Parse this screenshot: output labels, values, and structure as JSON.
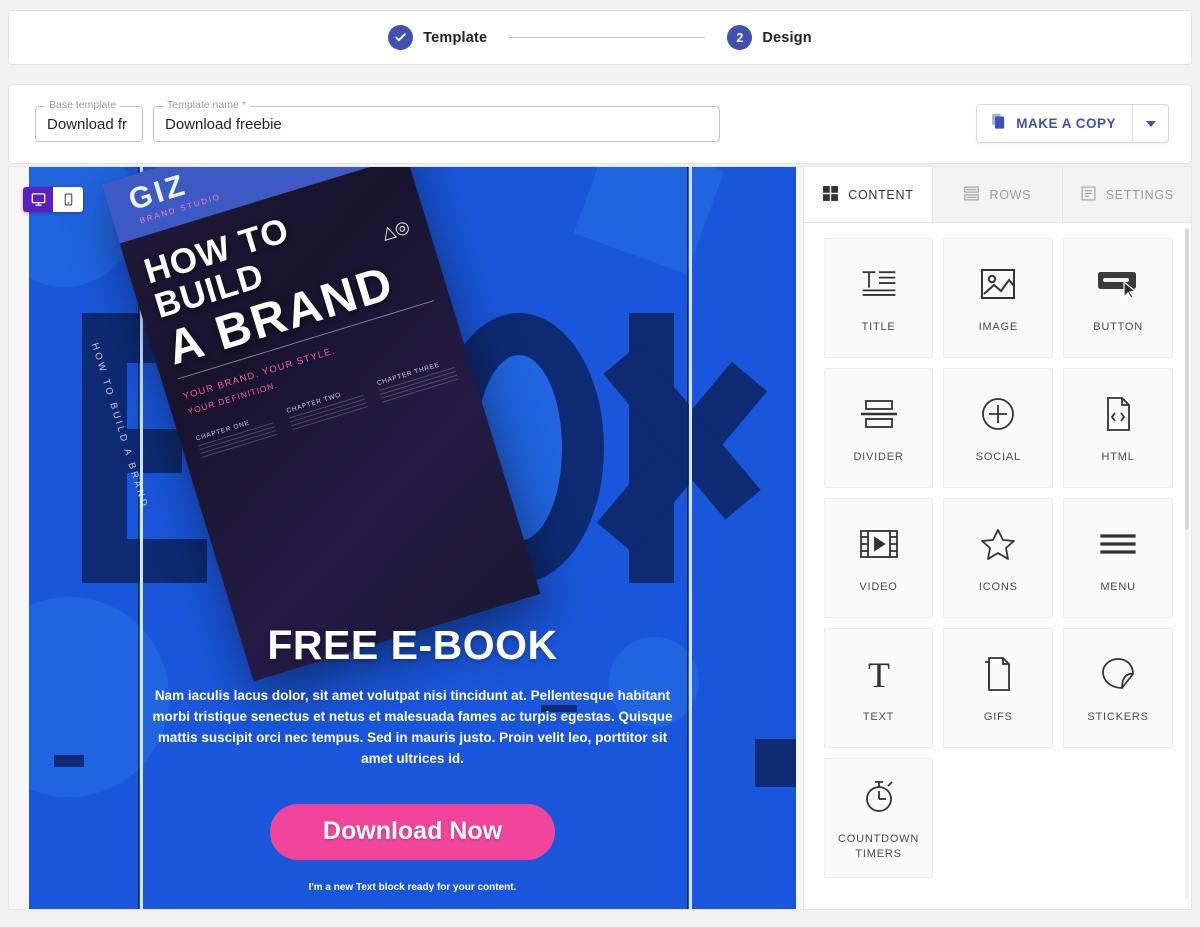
{
  "stepper": {
    "steps": [
      {
        "label": "Template",
        "state": "complete",
        "icon": "check-icon"
      },
      {
        "label": "Design",
        "state": "active",
        "number": "2"
      }
    ]
  },
  "toolbar": {
    "base_template": {
      "legend": "Base template",
      "value": "Download fr"
    },
    "template_name": {
      "legend": "Template name *",
      "value": "Download freebie"
    },
    "make_copy_label": "MAKE A COPY",
    "copy_icon": "copy-icon",
    "caret_icon": "chevron-down-icon",
    "accent": "#3f51b5"
  },
  "canvas": {
    "device_toggle": [
      {
        "name": "desktop",
        "icon": "desktop-icon",
        "active": true
      },
      {
        "name": "mobile",
        "icon": "mobile-icon",
        "active": false
      }
    ],
    "background_color": "#1a56db",
    "background_letters": "EBOOK",
    "book": {
      "brand": "GIZ",
      "brand_sub": "BRAND STUDIO",
      "title_line1": "HOW TO BUILD",
      "title_line2": "A BRAND",
      "tagline": "YOUR BRAND. YOUR STYLE.",
      "tagline2": "YOUR DEFINITION.",
      "spine": "HOW TO BUILD A BRAND",
      "logo": "△◎",
      "columns": [
        {
          "heading": "CHAPTER ONE"
        },
        {
          "heading": "CHAPTER TWO"
        },
        {
          "heading": "CHAPTER THREE"
        }
      ]
    },
    "hero": {
      "heading": "FREE E-BOOK",
      "paragraph": "Nam iaculis lacus dolor, sit amet volutpat nisi tincidunt at. Pellentesque habitant morbi tristique senectus et netus et malesuada fames ac turpis egestas. Quisque mattis suscipit orci nec tempus. Sed in mauris justo. Proin velit leo, porttitor sit amet ultrices id.",
      "cta_label": "Download Now",
      "cta_color": "#f0459b",
      "note": "I'm a new Text block ready for your content."
    }
  },
  "panel": {
    "tabs": [
      {
        "label": "CONTENT",
        "icon": "grid-icon",
        "active": true
      },
      {
        "label": "ROWS",
        "icon": "rows-icon",
        "active": false
      },
      {
        "label": "SETTINGS",
        "icon": "settings-doc-icon",
        "active": false
      }
    ],
    "blocks": [
      {
        "label": "TITLE",
        "icon": "title-icon"
      },
      {
        "label": "IMAGE",
        "icon": "image-icon"
      },
      {
        "label": "BUTTON",
        "icon": "button-icon"
      },
      {
        "label": "DIVIDER",
        "icon": "divider-icon"
      },
      {
        "label": "SOCIAL",
        "icon": "plus-circle-icon"
      },
      {
        "label": "HTML",
        "icon": "code-file-icon"
      },
      {
        "label": "VIDEO",
        "icon": "video-icon"
      },
      {
        "label": "ICONS",
        "icon": "star-icon"
      },
      {
        "label": "MENU",
        "icon": "hamburger-icon"
      },
      {
        "label": "TEXT",
        "icon": "text-t-icon"
      },
      {
        "label": "GIFS",
        "icon": "gif-file-icon"
      },
      {
        "label": "STICKERS",
        "icon": "sticker-icon"
      },
      {
        "label": "COUNTDOWN TIMERS",
        "icon": "timer-icon"
      }
    ]
  }
}
